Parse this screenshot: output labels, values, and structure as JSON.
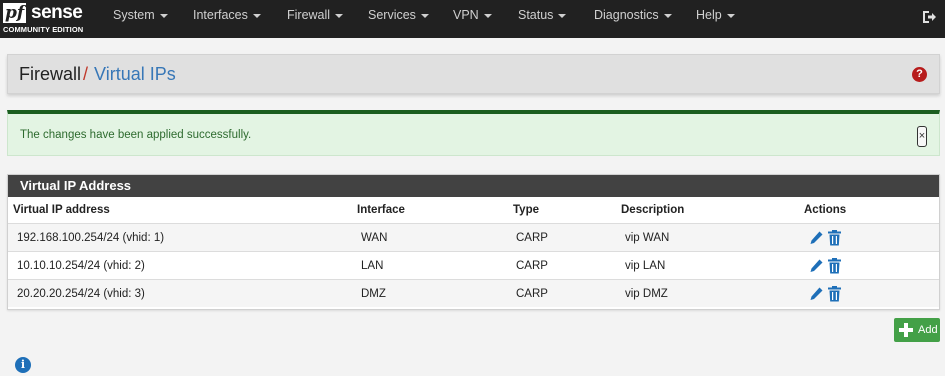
{
  "brand": {
    "pf": "pf",
    "sense": "sense",
    "edition": "COMMUNITY EDITION"
  },
  "nav": {
    "items": [
      {
        "label": "System"
      },
      {
        "label": "Interfaces"
      },
      {
        "label": "Firewall"
      },
      {
        "label": "Services"
      },
      {
        "label": "VPN"
      },
      {
        "label": "Status"
      },
      {
        "label": "Diagnostics"
      },
      {
        "label": "Help"
      }
    ],
    "logout_icon": "sign-out-icon"
  },
  "breadcrumb": {
    "parent": "Firewall",
    "separator": "/",
    "current": "Virtual IPs",
    "help_symbol": "?"
  },
  "alert": {
    "message": "The changes have been applied successfully.",
    "close_symbol": "×"
  },
  "table": {
    "title": "Virtual IP Address",
    "columns": [
      "Virtual IP address",
      "Interface",
      "Type",
      "Description",
      "Actions"
    ],
    "rows": [
      {
        "address": "192.168.100.254/24 (vhid: 1)",
        "interface": "WAN",
        "type": "CARP",
        "description": "vip WAN"
      },
      {
        "address": "10.10.10.254/24 (vhid: 2)",
        "interface": "LAN",
        "type": "CARP",
        "description": "vip LAN"
      },
      {
        "address": "20.20.20.254/24 (vhid: 3)",
        "interface": "DMZ",
        "type": "CARP",
        "description": "vip DMZ"
      }
    ]
  },
  "add_button": {
    "label": "Add"
  },
  "info_symbol": "i",
  "colors": {
    "navbar": "#212121",
    "link": "#3777b7",
    "success": "#43a047",
    "alert_border": "#1b5e20",
    "danger": "#b71c1c"
  }
}
